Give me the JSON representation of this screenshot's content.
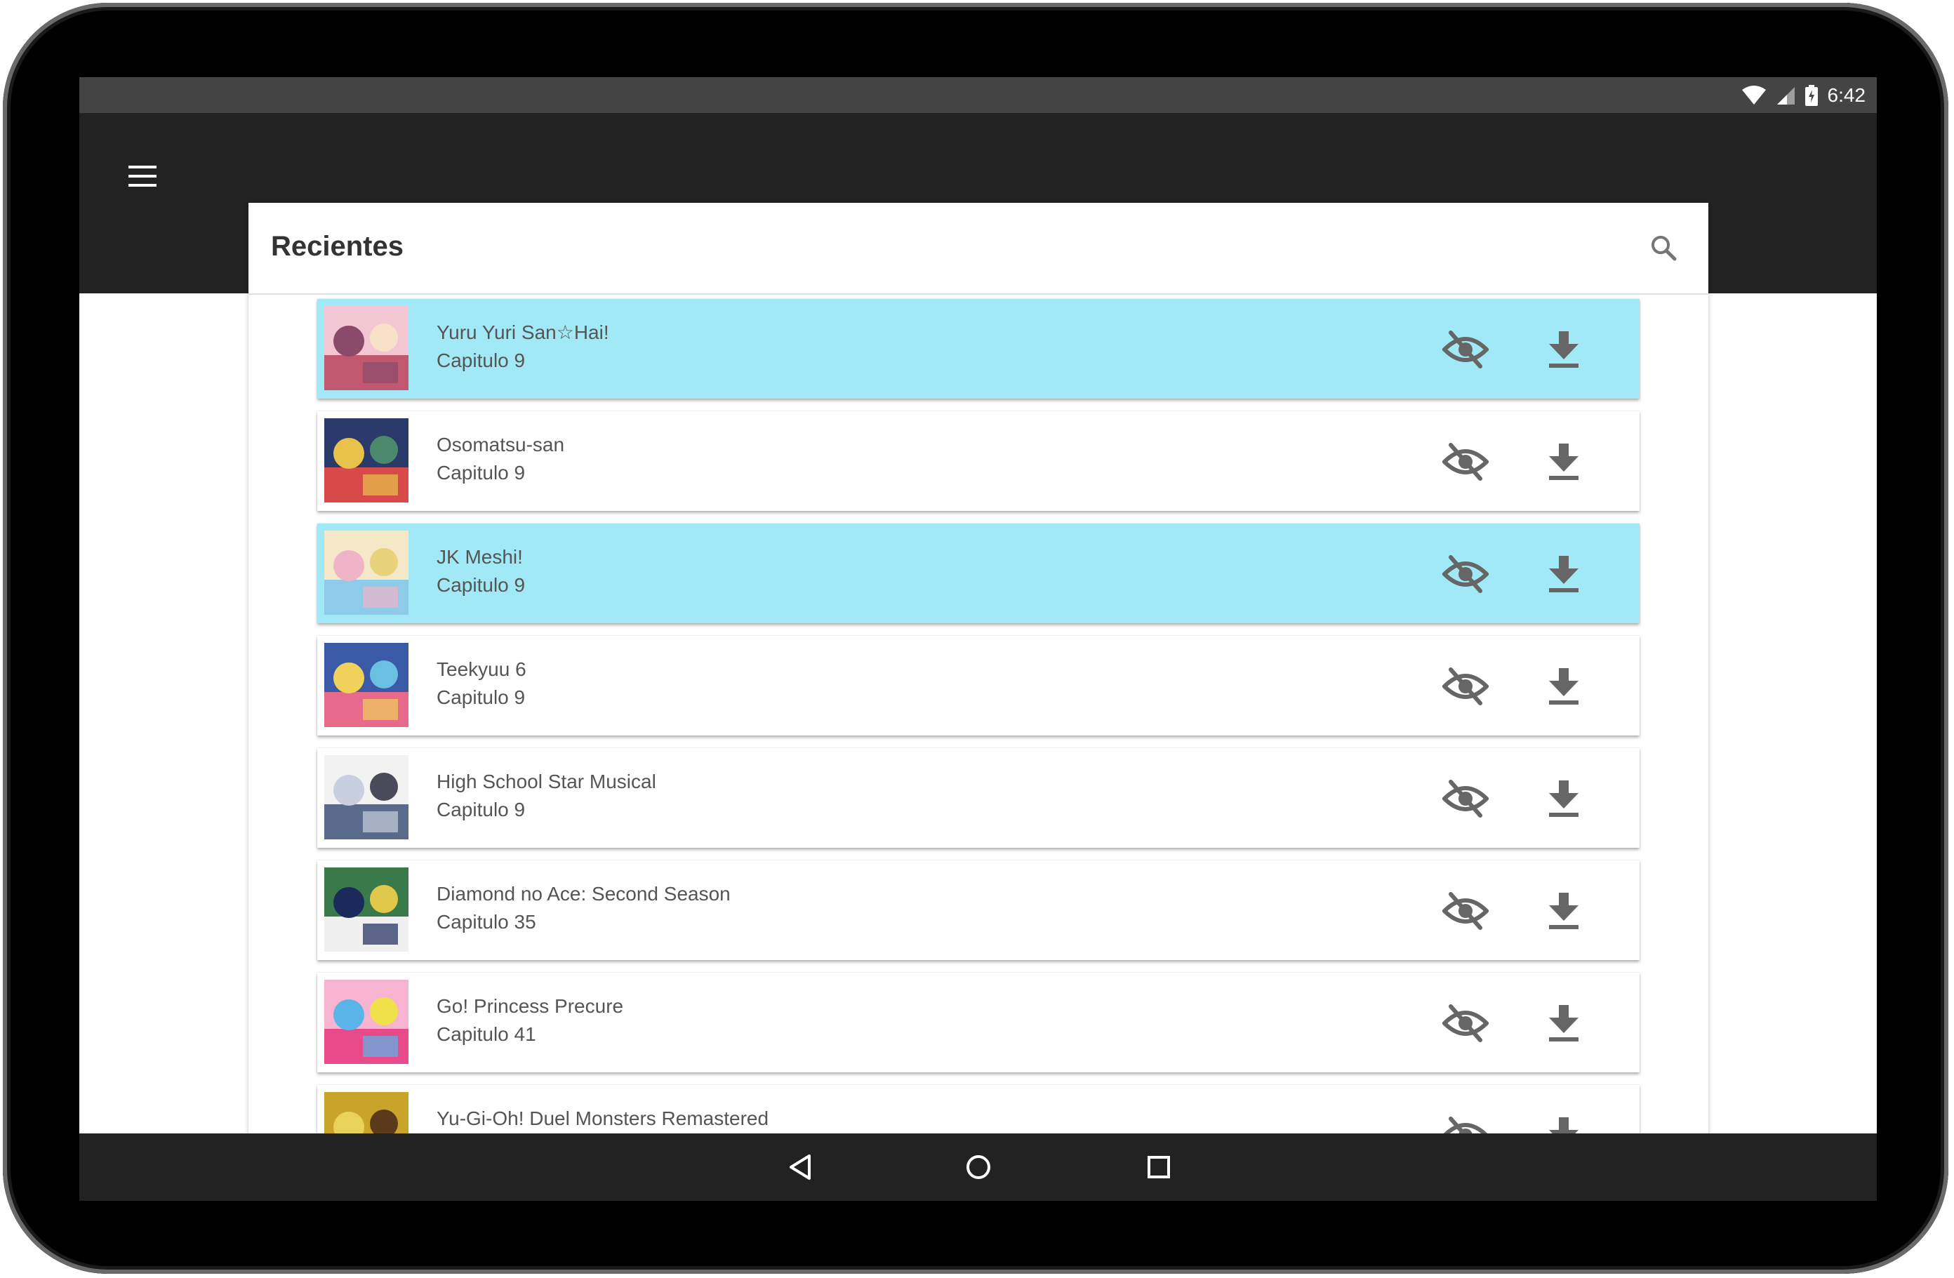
{
  "status_bar": {
    "time": "6:42"
  },
  "toolbar": {
    "menu_icon": "hamburger-menu-icon"
  },
  "card": {
    "title": "Recientes",
    "search_icon": "search-icon"
  },
  "items": [
    {
      "title": "Yuru Yuri San☆Hai!",
      "subtitle": "Capitulo 9",
      "highlighted": true
    },
    {
      "title": "Osomatsu-san",
      "subtitle": "Capitulo 9",
      "highlighted": false
    },
    {
      "title": "JK Meshi!",
      "subtitle": "Capitulo 9",
      "highlighted": true
    },
    {
      "title": "Teekyuu 6",
      "subtitle": "Capitulo 9",
      "highlighted": false
    },
    {
      "title": "High School Star Musical",
      "subtitle": "Capitulo 9",
      "highlighted": false
    },
    {
      "title": "Diamond no Ace: Second Season",
      "subtitle": "Capitulo 35",
      "highlighted": false
    },
    {
      "title": "Go! Princess Precure",
      "subtitle": "Capitulo 41",
      "highlighted": false
    },
    {
      "title": "Yu-Gi-Oh! Duel Monsters Remastered",
      "subtitle": "",
      "highlighted": false
    }
  ],
  "item_icons": {
    "seen": "eye-off-icon",
    "download": "download-icon"
  },
  "nav_bar": {
    "back": "back-icon",
    "home": "home-icon",
    "recents": "recents-icon"
  },
  "colors": {
    "highlight": "#a2e9f7",
    "toolbar": "#222222",
    "status_bar": "#444444",
    "icon_gray": "#666666"
  }
}
